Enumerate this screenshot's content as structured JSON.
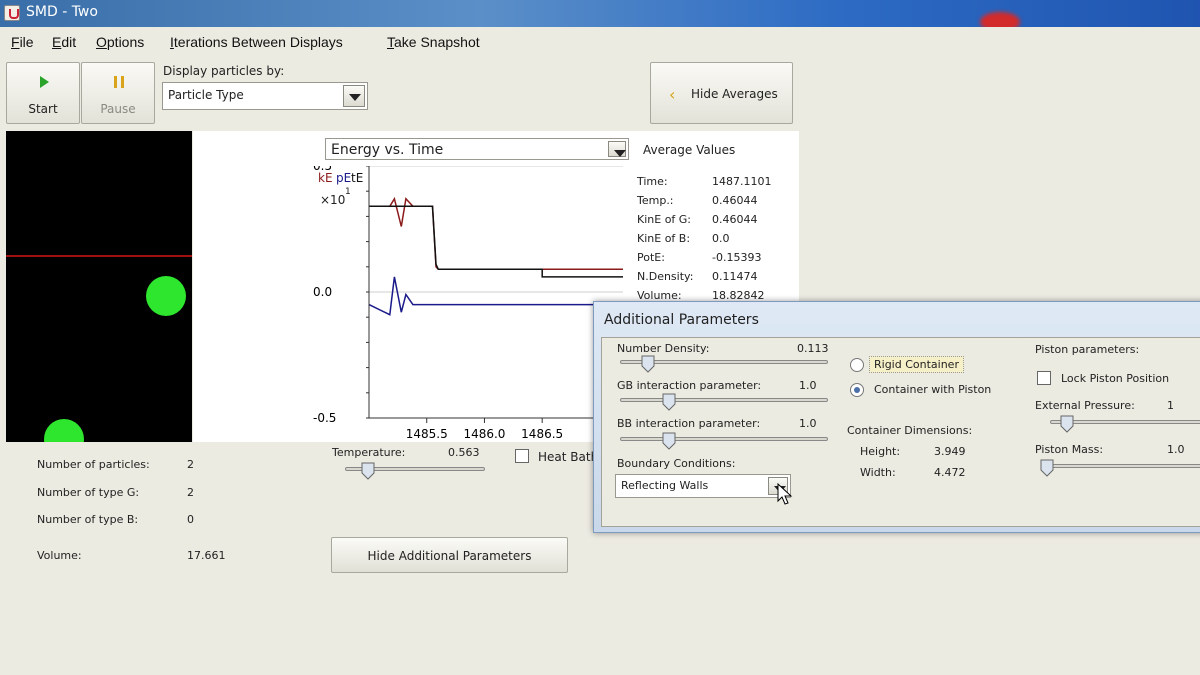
{
  "window": {
    "title": "SMD - Two"
  },
  "menu": [
    "File",
    "Edit",
    "Options",
    "Iterations Between Displays",
    "Take Snapshot"
  ],
  "toolbar": {
    "start": "Start",
    "pause": "Pause",
    "display_label": "Display particles by:",
    "display_value": "Particle Type",
    "hide_averages": "Hide Averages"
  },
  "graph": {
    "selector": "Energy vs. Time",
    "legend": {
      "ke": "kE",
      "pe": "pE",
      "te": "tE"
    },
    "multiplier": "×10",
    "multiplier_exp": "1"
  },
  "chart_data": {
    "type": "line",
    "title": "Energy vs. Time",
    "x_ticks": [
      "1485.5",
      "1486.0",
      "1486.5"
    ],
    "y_ticks": [
      "0.5",
      "0.0",
      "-0.5"
    ],
    "xlim": [
      1485.0,
      1487.2
    ],
    "ylim": [
      -0.5,
      0.5
    ],
    "series": [
      {
        "name": "kE",
        "color": "#8b1a1a",
        "x": [
          1485.0,
          1485.18,
          1485.22,
          1485.28,
          1485.32,
          1485.38,
          1485.42,
          1485.55,
          1485.58,
          1485.6,
          1486.0,
          1486.5,
          1486.55,
          1487.2
        ],
        "y": [
          0.34,
          0.34,
          0.37,
          0.26,
          0.37,
          0.34,
          0.34,
          0.34,
          0.1,
          0.09,
          0.09,
          0.09,
          0.09,
          0.09
        ]
      },
      {
        "name": "pE",
        "color": "#1a1a8b",
        "x": [
          1485.0,
          1485.18,
          1485.22,
          1485.28,
          1485.32,
          1485.38,
          1485.42,
          1485.55,
          1485.6,
          1487.2
        ],
        "y": [
          -0.05,
          -0.09,
          0.06,
          -0.08,
          -0.01,
          -0.05,
          -0.05,
          -0.05,
          -0.05,
          -0.05
        ]
      },
      {
        "name": "tE",
        "color": "#111111",
        "x": [
          1485.0,
          1485.55,
          1485.58,
          1485.6,
          1486.5,
          1486.5,
          1487.2
        ],
        "y": [
          0.34,
          0.34,
          0.11,
          0.09,
          0.09,
          0.06,
          0.06
        ]
      }
    ]
  },
  "averages": {
    "header": "Average Values",
    "rows": [
      {
        "label": "Time:",
        "value": "1487.1101"
      },
      {
        "label": "Temp.:",
        "value": "0.46044"
      },
      {
        "label": "KinE of G:",
        "value": "0.46044"
      },
      {
        "label": "KinE of B:",
        "value": "0.0"
      },
      {
        "label": "PotE:",
        "value": "-0.15393"
      },
      {
        "label": "N.Density:",
        "value": "0.11474"
      },
      {
        "label": "Volume:",
        "value": "18.82842"
      }
    ]
  },
  "stats": [
    {
      "label": "Number of particles:",
      "value": "2"
    },
    {
      "label": "Number of type G:",
      "value": "2"
    },
    {
      "label": "Number of type B:",
      "value": "0"
    },
    {
      "label": "Volume:",
      "value": "17.661"
    }
  ],
  "temperature": {
    "label": "Temperature:",
    "value": "0.563",
    "level": 0.08
  },
  "heat_bath": "Heat Bath",
  "hide_additional": "Hide Additional Parameters",
  "additional": {
    "title": "Additional Parameters",
    "number_density": {
      "label": "Number Density:",
      "value": "0.113",
      "level": 0.1
    },
    "gb": {
      "label": "GB interaction parameter:",
      "value": "1.0",
      "level": 0.2
    },
    "bb": {
      "label": "BB interaction parameter:",
      "value": "1.0",
      "level": 0.2
    },
    "boundary_label": "Boundary Conditions:",
    "boundary_value": "Reflecting Walls",
    "rigid": "Rigid Container",
    "piston": "Container with Piston",
    "dims_header": "Container Dimensions:",
    "height_label": "Height:",
    "height_value": "3.949",
    "width_label": "Width:",
    "width_value": "4.472",
    "piston_header": "Piston parameters:",
    "lock_piston": "Lock Piston Position",
    "ext_pressure_label": "External Pressure:",
    "ext_pressure_value": "1",
    "piston_mass_label": "Piston Mass:",
    "piston_mass_value": "1.0"
  }
}
